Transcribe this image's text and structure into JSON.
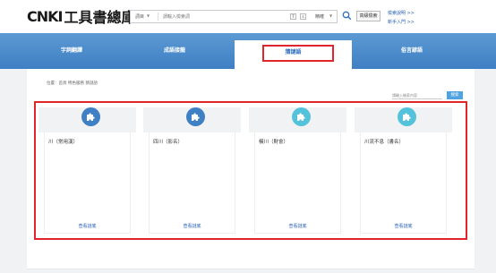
{
  "header": {
    "logo_cnki": "CNKI",
    "logo_title": "工具書總庫",
    "search_type": "詞目",
    "search_placeholder": "請輸入檢索詞",
    "btn_traditional": "T",
    "btn_simplified": "s",
    "match_mode": "精確",
    "advanced_search": "高級檢索",
    "link_help": "檢索說明 >>",
    "link_entry": "新手入門 >>"
  },
  "nav": {
    "tabs": [
      {
        "label": "字詞翻譯"
      },
      {
        "label": "成語接龍"
      },
      {
        "label": "猜謎語"
      },
      {
        "label": "俗言諺語"
      }
    ],
    "active_index": 2
  },
  "main": {
    "breadcrumb": "位置：首頁 特色服務 猜謎語",
    "in_search_placeholder": "請輸入檢索內容",
    "in_search_button": "搜索",
    "cards": [
      {
        "title": "川（常用漢）",
        "link": "查看謎底",
        "icon": "puzzle-icon",
        "icon_color": "#3f7fc3"
      },
      {
        "title": "四川（影名）",
        "link": "查看謎底",
        "icon": "puzzle-icon",
        "icon_color": "#3f7fc3"
      },
      {
        "title": "橫川（財會）",
        "link": "查看謎底",
        "icon": "puzzle-icon",
        "icon_color": "#55c2dc"
      },
      {
        "title": "川流不息（書名）",
        "link": "查看謎底",
        "icon": "puzzle-icon",
        "icon_color": "#55c2dc"
      }
    ]
  },
  "colors": {
    "band": "#4a8bcb",
    "highlight_red": "#e0262c",
    "link_blue": "#2a62b5"
  }
}
